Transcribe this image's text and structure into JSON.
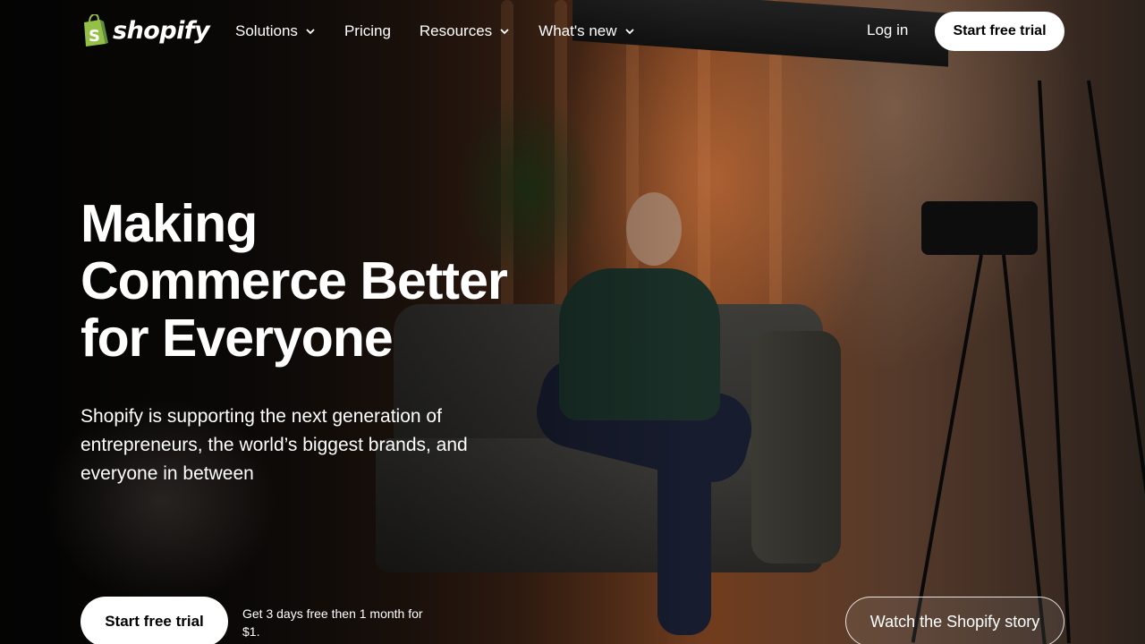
{
  "brand": {
    "name": "shopify",
    "logo_icon": "shopping-bag-icon",
    "logo_green": "#95BF47",
    "logo_dark_green": "#5E8E3E"
  },
  "nav": {
    "items": [
      {
        "label": "Solutions",
        "has_dropdown": true
      },
      {
        "label": "Pricing",
        "has_dropdown": false
      },
      {
        "label": "Resources",
        "has_dropdown": true
      },
      {
        "label": "What's new",
        "has_dropdown": true
      }
    ],
    "login_label": "Log in",
    "cta_label": "Start free trial"
  },
  "hero": {
    "headline": "Making Commerce Better for Everyone",
    "subtext": "Shopify is supporting the next generation of entrepreneurs, the world’s biggest brands, and everyone in between",
    "cta_label": "Start free trial",
    "trial_note": "Get 3 days free then 1 month for $1.",
    "watch_label": "Watch the Shopify story"
  },
  "colors": {
    "button_bg": "#FFFFFF",
    "button_text": "#000000",
    "text": "#FFFFFF"
  }
}
